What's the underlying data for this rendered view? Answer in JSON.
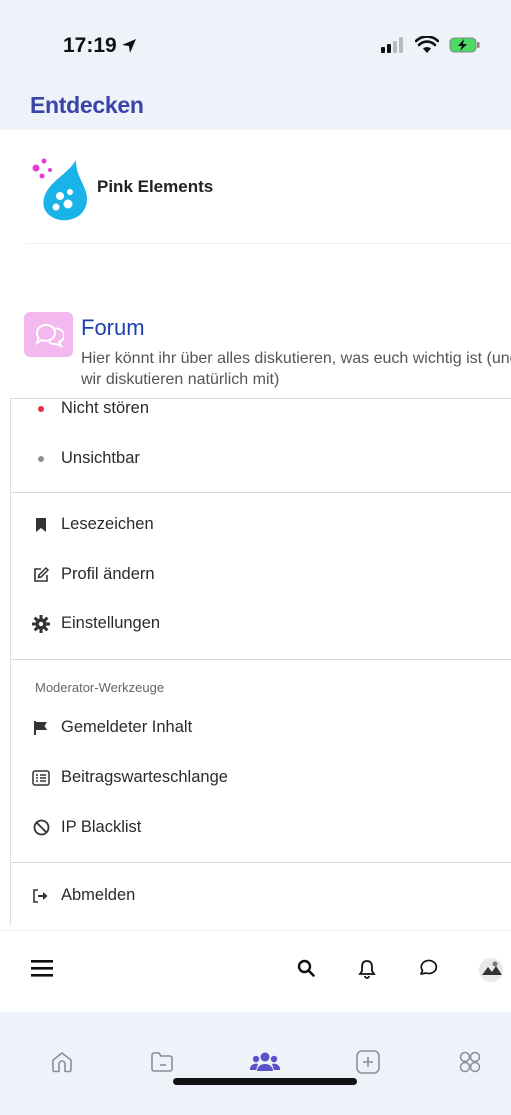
{
  "status": {
    "time": "17:19"
  },
  "header": {
    "title": "Entdecken"
  },
  "site": {
    "name": "Pink Elements"
  },
  "forum": {
    "title": "Forum",
    "description": "Hier könnt ihr über alles diskutieren, was euch wichtig ist (und wir diskutieren natürlich mit)"
  },
  "menu": {
    "status_items": [
      {
        "label": "Nicht stören",
        "color": "#e0323c"
      },
      {
        "label": "Unsichtbar",
        "color": "#8a9099"
      }
    ],
    "user_items": [
      {
        "label": "Lesezeichen",
        "icon": "bookmark-icon"
      },
      {
        "label": "Profil ändern",
        "icon": "edit-icon"
      },
      {
        "label": "Einstellungen",
        "icon": "gear-icon"
      }
    ],
    "moderator_label": "Moderator-Werkzeuge",
    "moderator_items": [
      {
        "label": "Gemeldeter Inhalt",
        "icon": "flag-icon"
      },
      {
        "label": "Beitragswarteschlange",
        "icon": "list-icon"
      },
      {
        "label": "IP Blacklist",
        "icon": "ban-icon"
      }
    ],
    "logout_label": "Abmelden"
  },
  "toolbar": {
    "icons": [
      "menu-icon",
      "search-icon",
      "bell-icon",
      "chat-icon",
      "avatar"
    ]
  },
  "tabbar": {
    "icons": [
      "home-icon",
      "folder-icon",
      "users-icon",
      "plus-icon",
      "grid-icon"
    ],
    "active": "users-icon"
  },
  "colors": {
    "accent": "#3a43a8",
    "forum_title": "#1f3fb3",
    "forum_icon_bg": "#f3b8ed",
    "chrome_bg": "#eef2f9"
  }
}
